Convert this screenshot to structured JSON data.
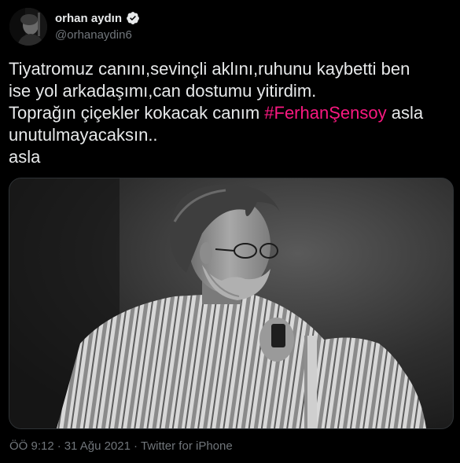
{
  "author": {
    "display_name": "orhan aydın",
    "handle": "@orhanaydin6",
    "verified_icon": "verified-badge-icon",
    "avatar_icon": "avatar-photo"
  },
  "tweet": {
    "line1": "Tiyatromuz canını,sevinçli aklını,ruhunu kaybetti ben",
    "line2": "ise yol arkadaşımı,can dostumu yitirdim.",
    "line3_before": "Toprağın çiçekler kokacak canım ",
    "hashtag": "#FerhanŞensoy",
    "line3_after": " asla",
    "line4": "unutulmayacaksın..",
    "line5": "asla"
  },
  "media": {
    "kind": "black-and-white photo of a bearded man with glasses in a striped shirt leaning on a cane"
  },
  "meta": {
    "time": "ÖÖ 9:12",
    "sep1": "·",
    "date": "31 Ağu 2021",
    "sep2": "·",
    "source": "Twitter for iPhone"
  },
  "colors": {
    "background": "#000000",
    "text": "#e7e9ea",
    "secondary": "#71767b",
    "hashtag": "#f91880",
    "verified": "#1d9bf0"
  }
}
